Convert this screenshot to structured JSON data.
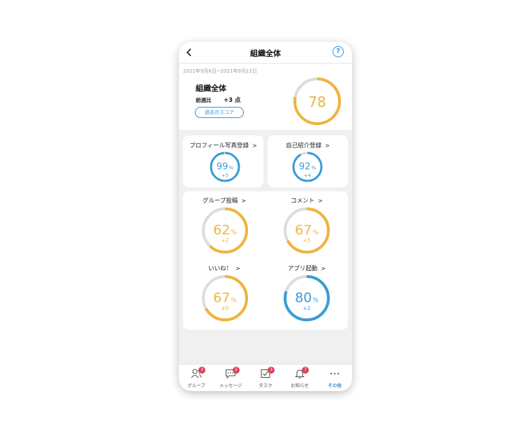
{
  "header": {
    "title": "組織全体"
  },
  "summary": {
    "date_range": "2021年9月6日~2021年9月12日",
    "org_name": "組織全体",
    "week_label": "前週比",
    "week_value": "+3 点",
    "past_score_button": "過去のスコア",
    "score": 78,
    "score_fraction": 0.78
  },
  "cards_small": [
    {
      "title": "プロフィール写真登録",
      "percent": "99",
      "fraction": 0.99,
      "delta": "+5",
      "color": "#3a9bd9"
    },
    {
      "title": "自己紹介登録",
      "percent": "92",
      "fraction": 0.92,
      "delta": "+4",
      "color": "#3a9bd9"
    }
  ],
  "cards_large": [
    {
      "title": "グループ投稿",
      "percent": "62",
      "fraction": 0.62,
      "delta": "+2",
      "color": "#f0b43c"
    },
    {
      "title": "コメント",
      "percent": "67",
      "fraction": 0.67,
      "delta": "+5",
      "color": "#f0b43c"
    },
    {
      "title": "いいね！",
      "percent": "67",
      "fraction": 0.67,
      "delta": "±0",
      "color": "#f0b43c"
    },
    {
      "title": "アプリ起動",
      "percent": "80",
      "fraction": 0.8,
      "delta": "+2",
      "color": "#3a9bd9"
    }
  ],
  "percent_unit": "%",
  "chevron": ">",
  "tabs": [
    {
      "label": "グループ",
      "icon": "group-icon",
      "badge": "3"
    },
    {
      "label": "メッセージ",
      "icon": "message-icon",
      "badge": "5"
    },
    {
      "label": "タスク",
      "icon": "task-icon",
      "badge": "3"
    },
    {
      "label": "お知らせ",
      "icon": "bell-icon",
      "badge": "7"
    },
    {
      "label": "その他",
      "icon": "more-icon",
      "badge": ""
    }
  ],
  "colors": {
    "accent": "#3a8fd6",
    "orange": "#f0b43c",
    "blue": "#3a9bd9",
    "track": "#dcdcdc",
    "badge": "#e0405a"
  }
}
